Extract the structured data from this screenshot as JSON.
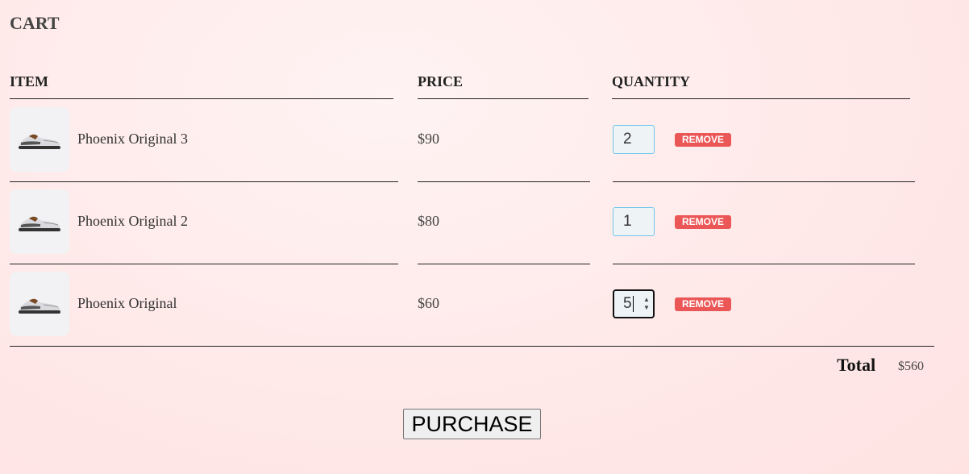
{
  "cart": {
    "title": "CART",
    "headers": {
      "item": "ITEM",
      "price": "PRICE",
      "quantity": "QUANTITY"
    },
    "items": [
      {
        "name": "Phoenix Original 3",
        "price": "$90",
        "quantity": "2",
        "remove_label": "REMOVE",
        "image_icon": "sneaker-image"
      },
      {
        "name": "Phoenix Original 2",
        "price": "$80",
        "quantity": "1",
        "remove_label": "REMOVE",
        "image_icon": "sneaker-image"
      },
      {
        "name": "Phoenix Original",
        "price": "$60",
        "quantity": "5",
        "remove_label": "REMOVE",
        "image_icon": "sneaker-image",
        "focused": true
      }
    ],
    "total_label": "Total",
    "total_value": "$560",
    "purchase_label": "PURCHASE"
  },
  "colors": {
    "remove_button": "#eb5757",
    "input_border": "#6ec6ea",
    "background": "#ffe8e8"
  }
}
